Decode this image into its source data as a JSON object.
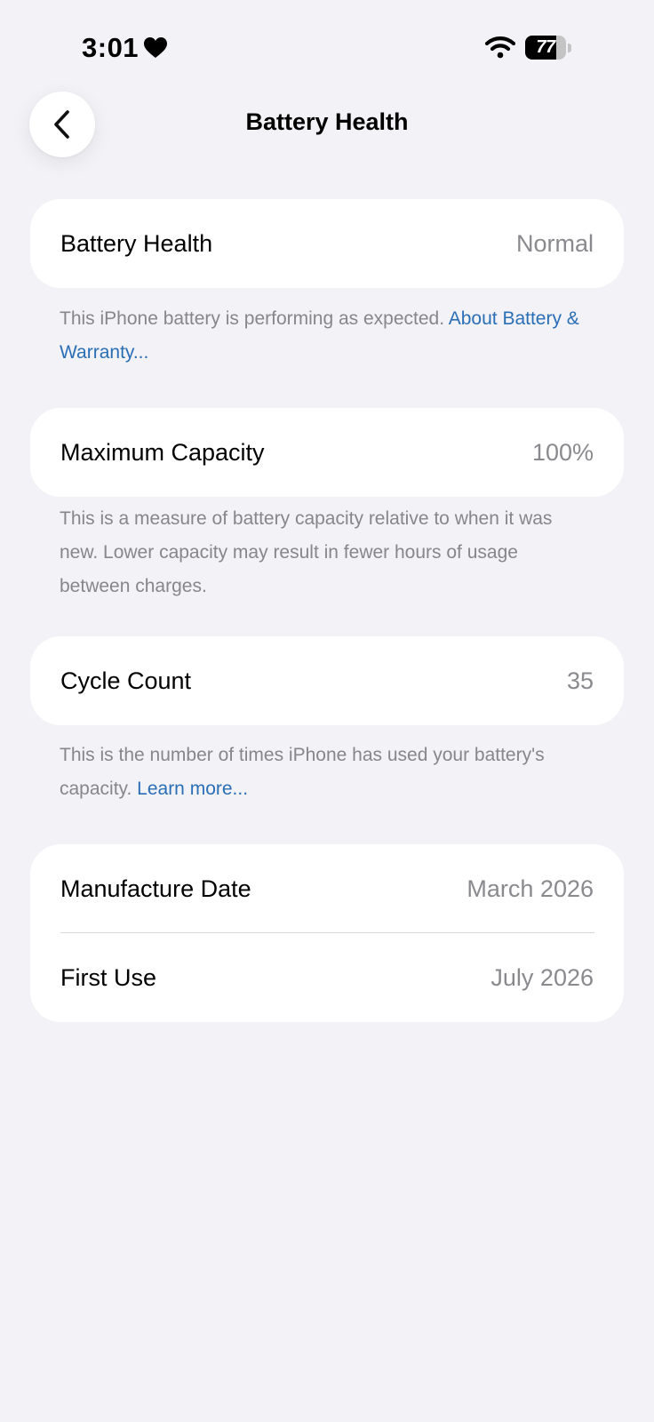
{
  "status_bar": {
    "time": "3:01",
    "battery_level": "77",
    "battery_fraction": 0.77,
    "icons": [
      "heart-icon",
      "wifi-icon",
      "battery-icon"
    ]
  },
  "nav": {
    "back_icon": "chevron-left-icon",
    "title": "Battery Health"
  },
  "sections": {
    "battery_health": {
      "label": "Battery Health",
      "value": "Normal",
      "footnote_text": "This iPhone battery is performing as expected. ",
      "footnote_link": "About Battery & Warranty..."
    },
    "maximum_capacity": {
      "label": "Maximum Capacity",
      "value": "100%",
      "footnote_text": "This is a measure of battery capacity relative to when it was new. Lower capacity may result in fewer hours of usage between charges."
    },
    "cycle_count": {
      "label": "Cycle Count",
      "value": "35",
      "footnote_text": "This is the number of times iPhone has used your battery's capacity. ",
      "footnote_link": "Learn more..."
    },
    "dates": {
      "manufacture_label": "Manufacture Date",
      "manufacture_value": "March 2026",
      "first_use_label": "First Use",
      "first_use_value": "July 2026"
    }
  },
  "colors": {
    "background": "#f2f2f7",
    "card": "#ffffff",
    "secondary_text": "#8a8a8e",
    "link": "#2a6fb5"
  }
}
